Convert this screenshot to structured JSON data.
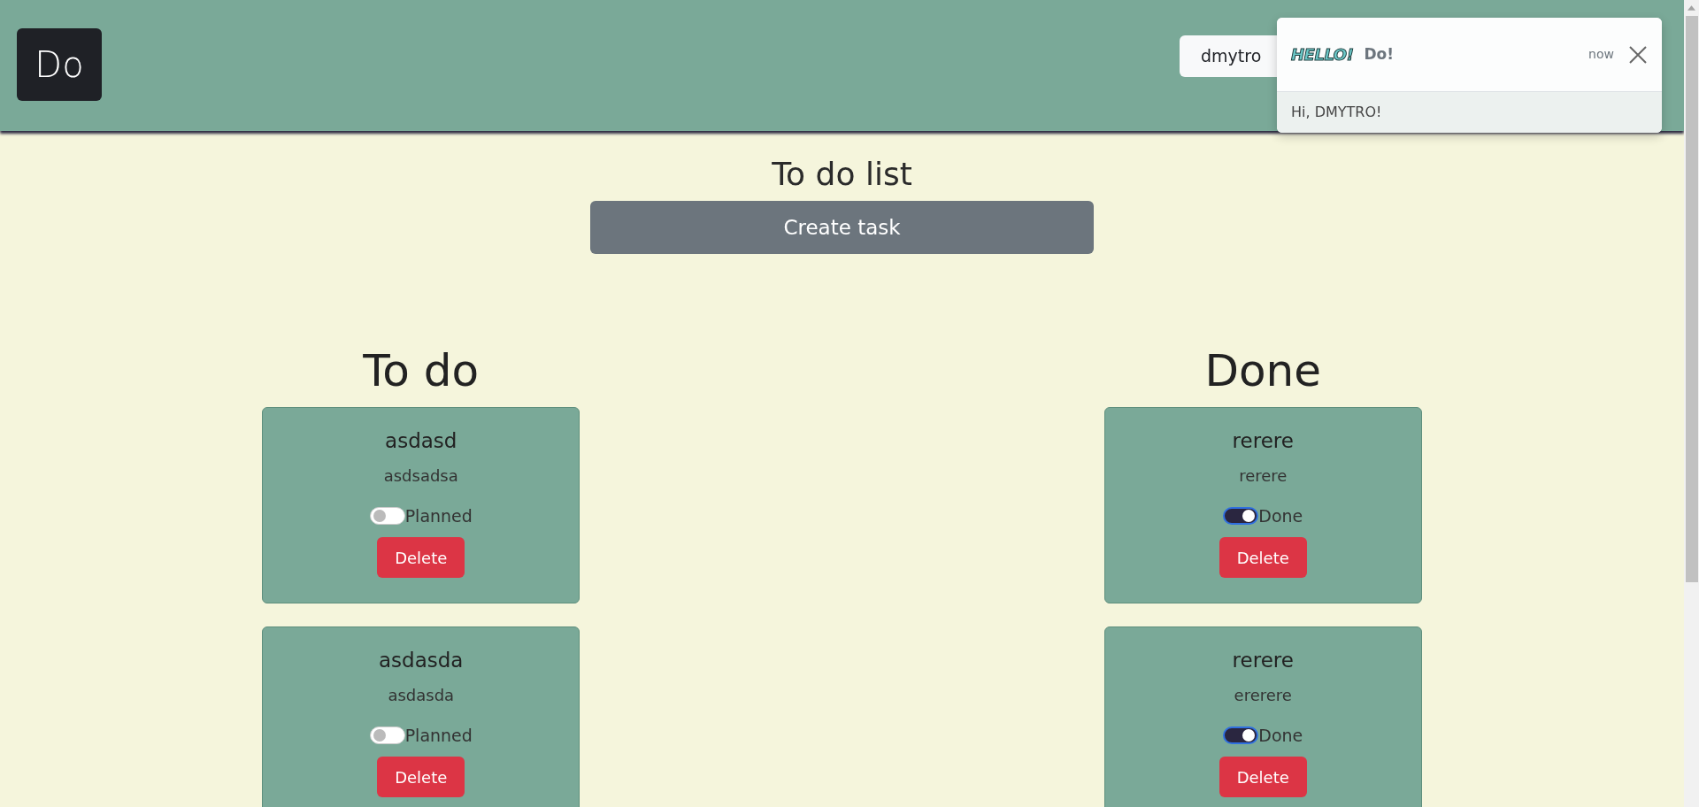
{
  "header": {
    "logo": "Do",
    "user_button": "dmytro"
  },
  "notification": {
    "badge": "HELLO!",
    "app": "Do!",
    "time": "now",
    "message": "Hi, DMYTRO!"
  },
  "page_title": "To do list",
  "create_button": "Create task",
  "columns": [
    {
      "title": "To do",
      "tasks": [
        {
          "title": "asdasd",
          "description": "asdsadsa",
          "on": false,
          "status": "Planned",
          "delete": "Delete"
        },
        {
          "title": "asdasda",
          "description": "asdasda",
          "on": false,
          "status": "Planned",
          "delete": "Delete"
        }
      ]
    },
    {
      "title": "Done",
      "tasks": [
        {
          "title": "rerere",
          "description": "rerere",
          "on": true,
          "status": "Done",
          "delete": "Delete"
        },
        {
          "title": "rerere",
          "description": "ererere",
          "on": true,
          "status": "Done",
          "delete": "Delete"
        }
      ]
    }
  ]
}
